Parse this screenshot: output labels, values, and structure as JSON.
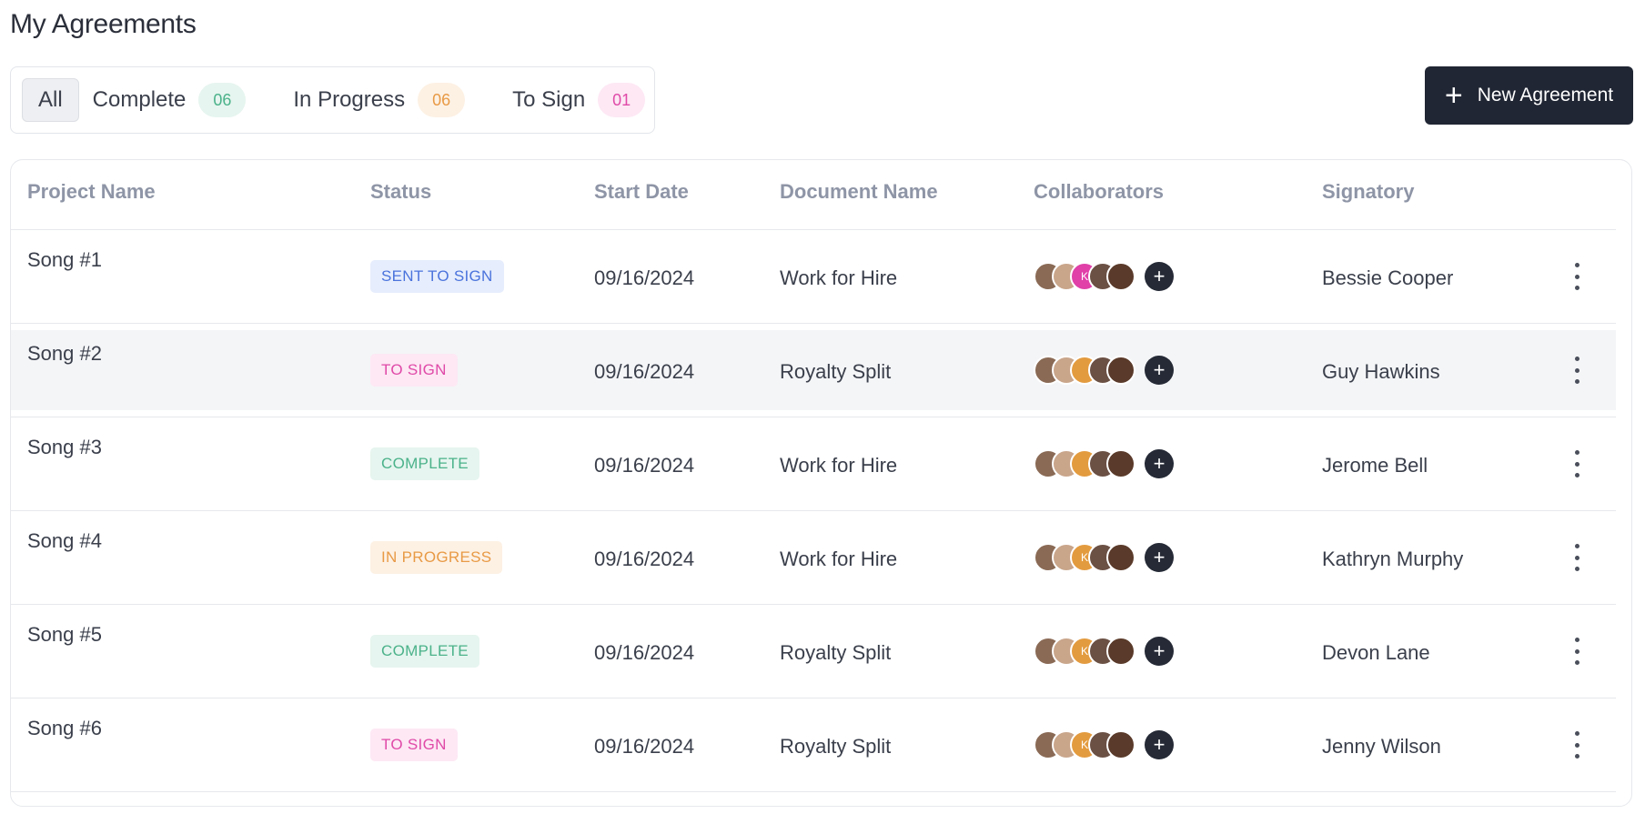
{
  "page": {
    "title": "My Agreements"
  },
  "filters": {
    "all": {
      "label": "All"
    },
    "complete": {
      "label": "Complete",
      "count": "06"
    },
    "in_progress": {
      "label": "In Progress",
      "count": "06"
    },
    "to_sign": {
      "label": "To Sign",
      "count": "01"
    }
  },
  "new_button": {
    "label": "New Agreement",
    "icon": "plus-icon"
  },
  "table": {
    "headers": {
      "project_name": "Project Name",
      "status": "Status",
      "start_date": "Start Date",
      "document_name": "Document Name",
      "collaborators": "Collaborators",
      "signatory": "Signatory"
    },
    "rows": [
      {
        "project": "Song #1",
        "status": "SENT TO SIGN",
        "status_color": "blue",
        "date": "09/16/2024",
        "document": "Work for Hire",
        "signatory": "Bessie Cooper",
        "avatars": [
          {
            "initial": "",
            "color": "#8a6a55"
          },
          {
            "initial": "",
            "color": "#c9a58a"
          },
          {
            "initial": "K",
            "color": "#e040a8"
          },
          {
            "initial": "",
            "color": "#6b5044"
          },
          {
            "initial": "",
            "color": "#5a3a2a"
          }
        ]
      },
      {
        "project": "Song #2",
        "status": "TO SIGN",
        "status_color": "pink",
        "date": "09/16/2024",
        "document": "Royalty Split",
        "signatory": "Guy Hawkins",
        "avatars": [
          {
            "initial": "",
            "color": "#8a6a55"
          },
          {
            "initial": "",
            "color": "#c9a58a"
          },
          {
            "initial": "",
            "color": "#e39b3f"
          },
          {
            "initial": "",
            "color": "#6b5044"
          },
          {
            "initial": "",
            "color": "#5a3a2a"
          }
        ]
      },
      {
        "project": "Song #3",
        "status": "COMPLETE",
        "status_color": "green",
        "date": "09/16/2024",
        "document": "Work for Hire",
        "signatory": "Jerome Bell",
        "avatars": [
          {
            "initial": "",
            "color": "#8a6a55"
          },
          {
            "initial": "",
            "color": "#c9a58a"
          },
          {
            "initial": "",
            "color": "#e39b3f"
          },
          {
            "initial": "",
            "color": "#6b5044"
          },
          {
            "initial": "",
            "color": "#5a3a2a"
          }
        ]
      },
      {
        "project": "Song #4",
        "status": "IN PROGRESS",
        "status_color": "orange",
        "date": "09/16/2024",
        "document": "Work for Hire",
        "signatory": "Kathryn Murphy",
        "avatars": [
          {
            "initial": "",
            "color": "#8a6a55"
          },
          {
            "initial": "",
            "color": "#c9a58a"
          },
          {
            "initial": "K",
            "color": "#e39b3f"
          },
          {
            "initial": "",
            "color": "#6b5044"
          },
          {
            "initial": "",
            "color": "#5a3a2a"
          }
        ]
      },
      {
        "project": "Song #5",
        "status": "COMPLETE",
        "status_color": "green",
        "date": "09/16/2024",
        "document": "Royalty Split",
        "signatory": "Devon Lane",
        "avatars": [
          {
            "initial": "",
            "color": "#8a6a55"
          },
          {
            "initial": "",
            "color": "#c9a58a"
          },
          {
            "initial": "K",
            "color": "#e39b3f"
          },
          {
            "initial": "",
            "color": "#6b5044"
          },
          {
            "initial": "",
            "color": "#5a3a2a"
          }
        ]
      },
      {
        "project": "Song #6",
        "status": "TO SIGN",
        "status_color": "pink",
        "date": "09/16/2024",
        "document": "Royalty Split",
        "signatory": "Jenny Wilson",
        "avatars": [
          {
            "initial": "",
            "color": "#8a6a55"
          },
          {
            "initial": "",
            "color": "#c9a58a"
          },
          {
            "initial": "K",
            "color": "#e39b3f"
          },
          {
            "initial": "",
            "color": "#6b5044"
          },
          {
            "initial": "",
            "color": "#5a3a2a"
          }
        ]
      }
    ],
    "highlighted_row": 1,
    "row_actions_icon": "more-vertical-icon",
    "add_collaborator_icon": "plus-icon"
  },
  "colors": {
    "primary_dark": "#212634",
    "status_blue": "#4a73dc",
    "status_pink": "#e04aa8",
    "status_green": "#4bb28b",
    "status_orange": "#e89a45"
  }
}
